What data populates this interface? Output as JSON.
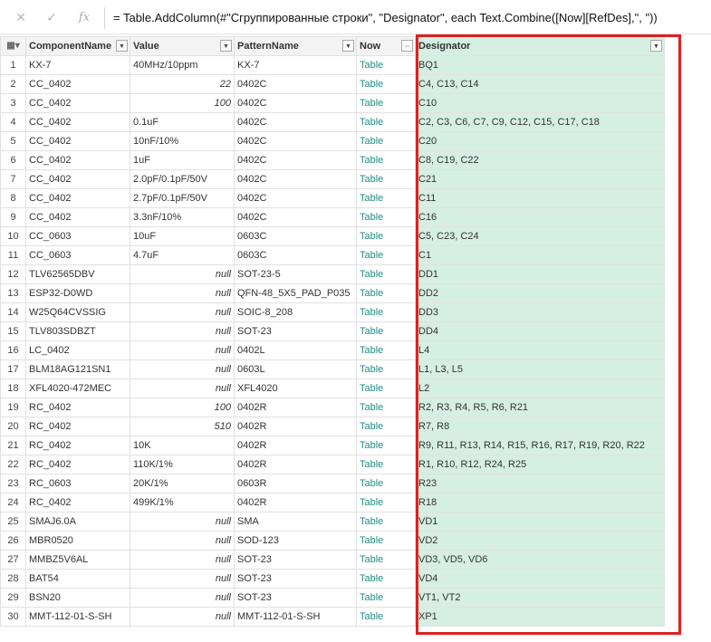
{
  "formula_bar": {
    "cancel_icon": "✕",
    "confirm_icon": "✓",
    "fx_label": "fx",
    "formula": "= Table.AddColumn(#\"Сгруппированные строки\", \"Designator\", each Text.Combine([Now][RefDes],\", \"))"
  },
  "columns": [
    {
      "label": "ComponentName",
      "type_icon": "table-cell-icon"
    },
    {
      "label": "Value"
    },
    {
      "label": "PatternName"
    },
    {
      "label": "Now",
      "expand_icon": "expand-columns-icon"
    },
    {
      "label": "Designator"
    }
  ],
  "rows": [
    {
      "n": "1",
      "c": "KX-7",
      "v": "40MHz/10ppm",
      "p": "KX-7",
      "now": "Table",
      "d": "BQ1"
    },
    {
      "n": "2",
      "c": "CC_0402",
      "v": "22",
      "p": "0402C",
      "now": "Table",
      "d": "C4, C13, C14"
    },
    {
      "n": "3",
      "c": "CC_0402",
      "v": "100",
      "p": "0402C",
      "now": "Table",
      "d": "C10"
    },
    {
      "n": "4",
      "c": "CC_0402",
      "v": "0.1uF",
      "p": "0402C",
      "now": "Table",
      "d": "C2, C3, C6, C7, C9, C12, C15, C17, C18"
    },
    {
      "n": "5",
      "c": "CC_0402",
      "v": "10nF/10%",
      "p": "0402C",
      "now": "Table",
      "d": "C20"
    },
    {
      "n": "6",
      "c": "CC_0402",
      "v": "1uF",
      "p": "0402C",
      "now": "Table",
      "d": "C8, C19, C22"
    },
    {
      "n": "7",
      "c": "CC_0402",
      "v": "2.0pF/0.1pF/50V",
      "p": "0402C",
      "now": "Table",
      "d": "C21"
    },
    {
      "n": "8",
      "c": "CC_0402",
      "v": "2.7pF/0.1pF/50V",
      "p": "0402C",
      "now": "Table",
      "d": "C11"
    },
    {
      "n": "9",
      "c": "CC_0402",
      "v": "3.3nF/10%",
      "p": "0402C",
      "now": "Table",
      "d": "C16"
    },
    {
      "n": "10",
      "c": "CC_0603",
      "v": "10uF",
      "p": "0603C",
      "now": "Table",
      "d": "C5, C23, C24"
    },
    {
      "n": "11",
      "c": "CC_0603",
      "v": "4.7uF",
      "p": "0603C",
      "now": "Table",
      "d": "C1"
    },
    {
      "n": "12",
      "c": "TLV62565DBV",
      "v": "null",
      "p": "SOT-23-5",
      "now": "Table",
      "d": "DD1"
    },
    {
      "n": "13",
      "c": "ESP32-D0WD",
      "v": "null",
      "p": "QFN-48_5X5_PAD_P035",
      "now": "Table",
      "d": "DD2"
    },
    {
      "n": "14",
      "c": "W25Q64CVSSIG",
      "v": "null",
      "p": "SOIC-8_208",
      "now": "Table",
      "d": "DD3"
    },
    {
      "n": "15",
      "c": "TLV803SDBZT",
      "v": "null",
      "p": "SOT-23",
      "now": "Table",
      "d": "DD4"
    },
    {
      "n": "16",
      "c": "LC_0402",
      "v": "null",
      "p": "0402L",
      "now": "Table",
      "d": "L4"
    },
    {
      "n": "17",
      "c": "BLM18AG121SN1",
      "v": "null",
      "p": "0603L",
      "now": "Table",
      "d": "L1, L3, L5"
    },
    {
      "n": "18",
      "c": "XFL4020-472MEC",
      "v": "null",
      "p": "XFL4020",
      "now": "Table",
      "d": "L2"
    },
    {
      "n": "19",
      "c": "RC_0402",
      "v": "100",
      "p": "0402R",
      "now": "Table",
      "d": "R2, R3, R4, R5, R6, R21"
    },
    {
      "n": "20",
      "c": "RC_0402",
      "v": "510",
      "p": "0402R",
      "now": "Table",
      "d": "R7, R8"
    },
    {
      "n": "21",
      "c": "RC_0402",
      "v": "10K",
      "p": "0402R",
      "now": "Table",
      "d": "R9, R11, R13, R14, R15, R16, R17, R19, R20, R22"
    },
    {
      "n": "22",
      "c": "RC_0402",
      "v": "110K/1%",
      "p": "0402R",
      "now": "Table",
      "d": "R1, R10, R12, R24, R25"
    },
    {
      "n": "23",
      "c": "RC_0603",
      "v": "20K/1%",
      "p": "0603R",
      "now": "Table",
      "d": "R23"
    },
    {
      "n": "24",
      "c": "RC_0402",
      "v": "499K/1%",
      "p": "0402R",
      "now": "Table",
      "d": "R18"
    },
    {
      "n": "25",
      "c": "SMAJ6.0A",
      "v": "null",
      "p": "SMA",
      "now": "Table",
      "d": "VD1"
    },
    {
      "n": "26",
      "c": "MBR0520",
      "v": "null",
      "p": "SOD-123",
      "now": "Table",
      "d": "VD2"
    },
    {
      "n": "27",
      "c": "MMBZ5V6AL",
      "v": "null",
      "p": "SOT-23",
      "now": "Table",
      "d": "VD3, VD5, VD6"
    },
    {
      "n": "28",
      "c": "BAT54",
      "v": "null",
      "p": "SOT-23",
      "now": "Table",
      "d": "VD4"
    },
    {
      "n": "29",
      "c": "BSN20",
      "v": "null",
      "p": "SOT-23",
      "now": "Table",
      "d": "VT1, VT2"
    },
    {
      "n": "30",
      "c": "MMT-112-01-S-SH",
      "v": "null",
      "p": "MMT-112-01-S-SH",
      "now": "Table",
      "d": "XP1"
    }
  ],
  "colors": {
    "accent_table_link": "#1f8e84",
    "designator_bg": "#d6efe3",
    "highlight_border": "#e02020"
  }
}
